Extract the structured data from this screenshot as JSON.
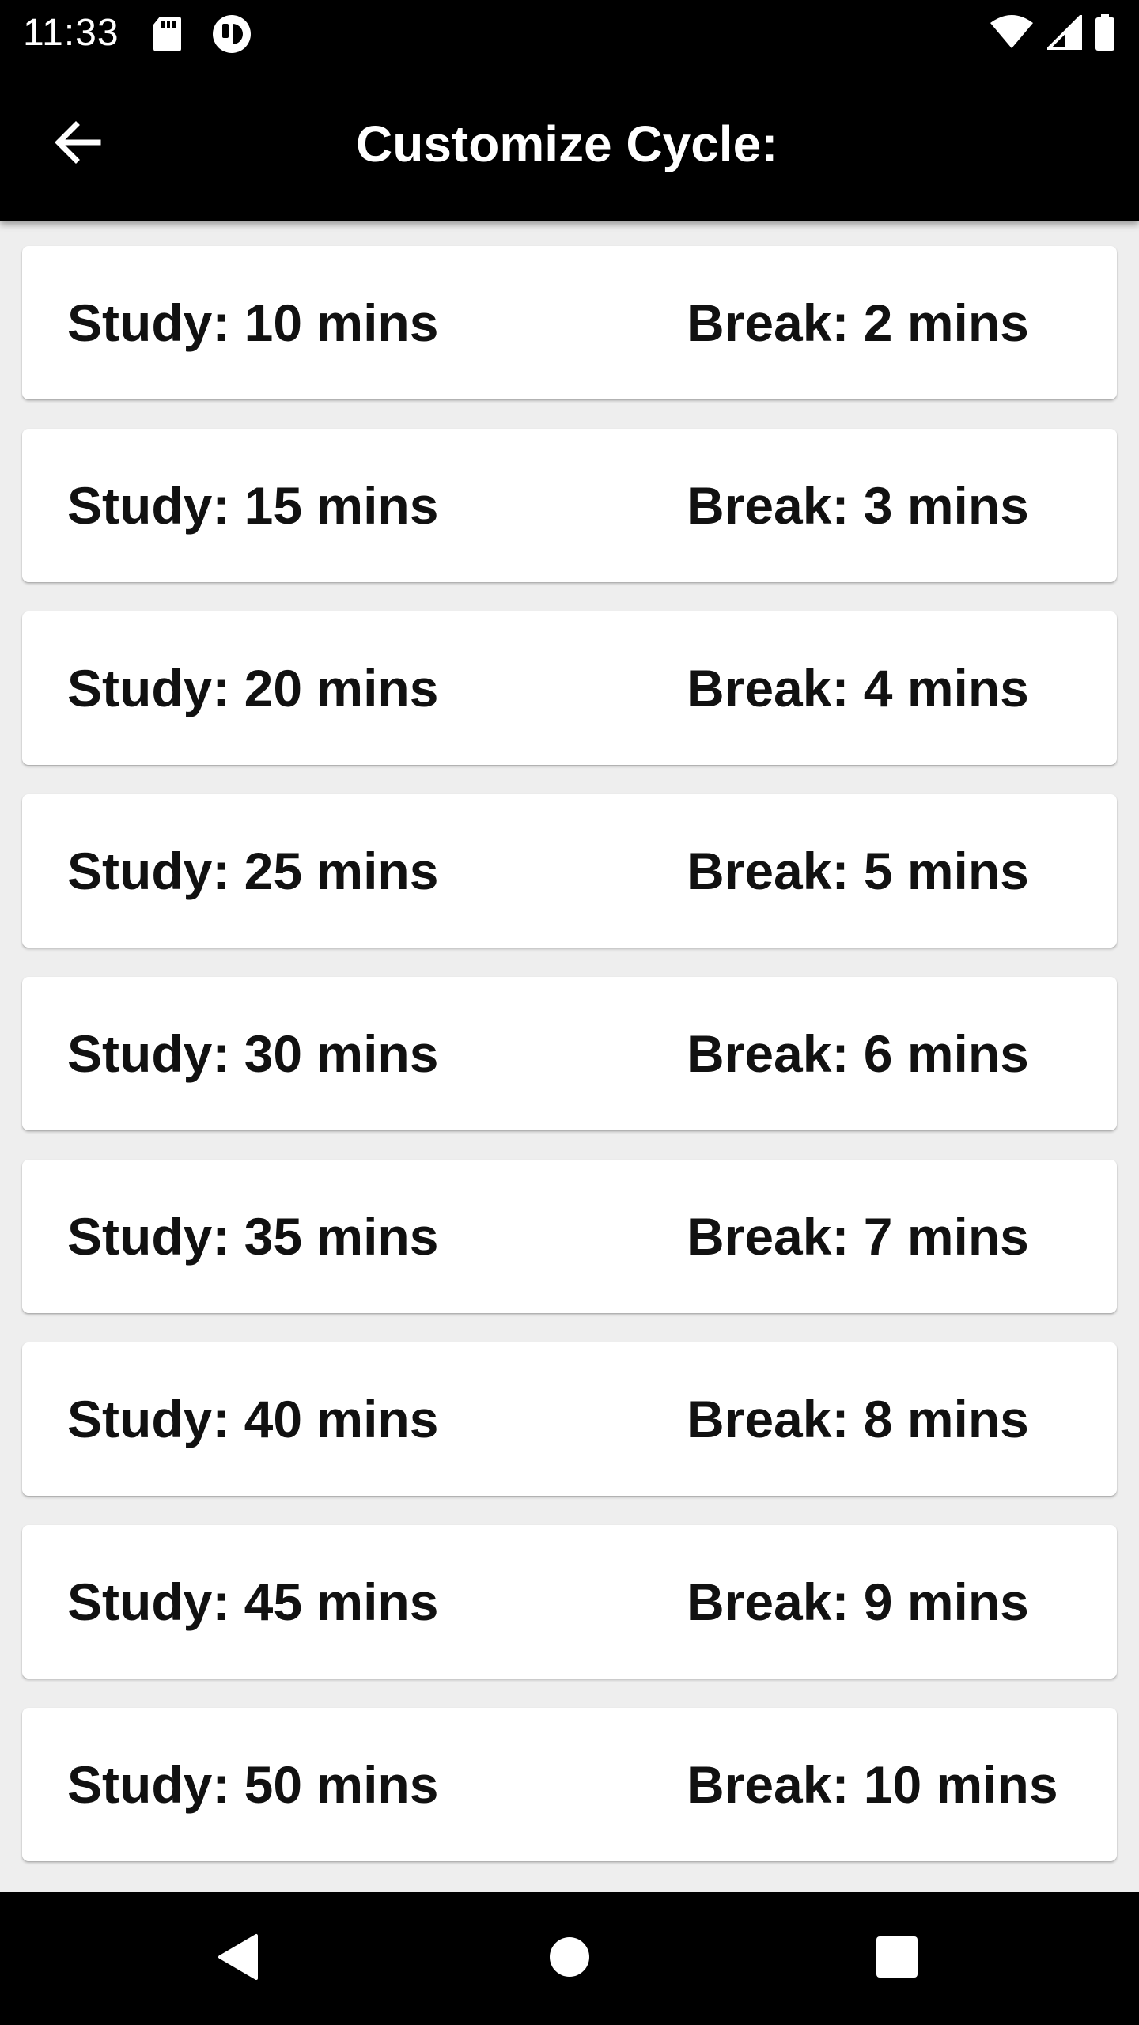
{
  "status_bar": {
    "time": "11:33",
    "icons": [
      "sd-card-icon",
      "notification-app-icon",
      "wifi-icon",
      "cellular-signal-icon",
      "battery-icon"
    ]
  },
  "app_bar": {
    "title": "Customize Cycle:",
    "back_icon": "arrow-back-icon"
  },
  "cycles": [
    {
      "study": "Study: 10 mins",
      "break": "Break: 2 mins"
    },
    {
      "study": "Study: 15 mins",
      "break": "Break: 3 mins"
    },
    {
      "study": "Study: 20 mins",
      "break": "Break: 4 mins"
    },
    {
      "study": "Study: 25 mins",
      "break": "Break: 5 mins"
    },
    {
      "study": "Study: 30 mins",
      "break": "Break: 6 mins"
    },
    {
      "study": "Study: 35 mins",
      "break": "Break: 7 mins"
    },
    {
      "study": "Study: 40 mins",
      "break": "Break: 8 mins"
    },
    {
      "study": "Study: 45 mins",
      "break": "Break: 9 mins"
    },
    {
      "study": "Study: 50 mins",
      "break": "Break: 10 mins"
    }
  ],
  "nav_bar": {
    "icons": [
      "nav-back-triangle-icon",
      "nav-home-circle-icon",
      "nav-recents-square-icon"
    ]
  },
  "colors": {
    "app_bar_bg": "#000000",
    "content_bg": "#eeeeee",
    "card_bg": "#ffffff",
    "text": "#111111"
  }
}
